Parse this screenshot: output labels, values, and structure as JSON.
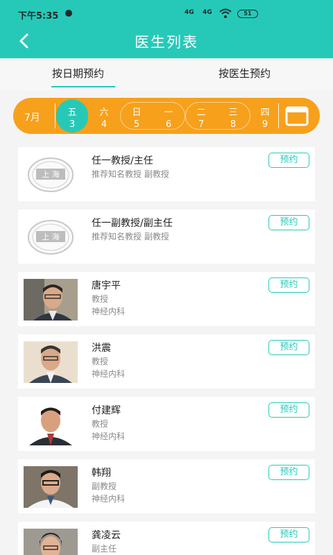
{
  "status_bar": {
    "time": "下午5:35",
    "signal1": "4G",
    "signal2": "4G",
    "battery": "51"
  },
  "header": {
    "title": "医生列表"
  },
  "tabs": [
    {
      "label": "按日期预约"
    },
    {
      "label": "按医生预约"
    }
  ],
  "date_strip": {
    "month": "7月",
    "days": [
      {
        "weekday": "五",
        "date": "3"
      },
      {
        "weekday": "六",
        "date": "4"
      },
      {
        "weekday": "日",
        "date": "5"
      },
      {
        "weekday": "一",
        "date": "6"
      },
      {
        "weekday": "二",
        "date": "7"
      },
      {
        "weekday": "三",
        "date": "8"
      },
      {
        "weekday": "四",
        "date": "9"
      }
    ]
  },
  "doctors": [
    {
      "name": "任一教授/主任",
      "line1": "推荐知名教授 副教授",
      "line2": "",
      "button": "预约",
      "avatar": "hospital-logo",
      "logo_text": "上 海"
    },
    {
      "name": "任一副教授/副主任",
      "line1": "推荐知名教授 副教授",
      "line2": "",
      "button": "预约",
      "avatar": "hospital-logo",
      "logo_text": "上 海"
    },
    {
      "name": "唐宇平",
      "line1": "教授",
      "line2": "神经内科",
      "button": "预约",
      "avatar": "photo"
    },
    {
      "name": "洪震",
      "line1": "教授",
      "line2": "神经内科",
      "button": "预约",
      "avatar": "photo"
    },
    {
      "name": "付建辉",
      "line1": "教授",
      "line2": "神经内科",
      "button": "预约",
      "avatar": "photo"
    },
    {
      "name": "韩翔",
      "line1": "副教授",
      "line2": "神经内科",
      "button": "预约",
      "avatar": "photo"
    },
    {
      "name": "龚凌云",
      "line1": "副主任",
      "line2": "",
      "button": "预约",
      "avatar": "photo"
    }
  ],
  "colors": {
    "primary": "#26c9b8",
    "date_strip": "#f7a01b"
  }
}
